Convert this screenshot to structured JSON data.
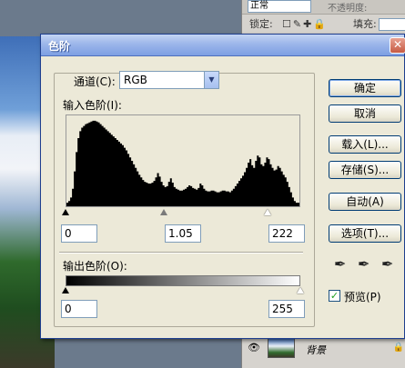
{
  "background": {
    "layers_panel": {
      "blend_mode": "正常",
      "opacity_label": "不透明度:",
      "lock_label": "锁定:",
      "lock_icons": "☐✎✚🔒",
      "fill_label": "填充:",
      "layer_name": "背景"
    }
  },
  "dialog": {
    "title": "色阶",
    "channel_label": "通道(C):",
    "channel_value": "RGB",
    "input_levels_label": "输入色阶(I):",
    "input_black": "0",
    "input_gamma": "1.05",
    "input_white": "222",
    "output_levels_label": "输出色阶(O):",
    "output_black": "0",
    "output_white": "255",
    "buttons": {
      "ok": "确定",
      "cancel": "取消",
      "load": "载入(L)...",
      "save": "存储(S)...",
      "auto": "自动(A)",
      "options": "选项(T)..."
    },
    "preview_label": "预览(P)",
    "preview_checked": true,
    "close_glyph": "✕"
  },
  "histogram": {
    "levels": [
      4,
      6,
      10,
      20,
      40,
      62,
      78,
      86,
      90,
      92,
      94,
      95,
      96,
      97,
      98,
      98,
      97,
      96,
      94,
      92,
      90,
      88,
      86,
      84,
      82,
      80,
      78,
      76,
      74,
      72,
      70,
      67,
      64,
      60,
      56,
      52,
      48,
      44,
      40,
      36,
      33,
      30,
      28,
      27,
      26,
      26,
      27,
      29,
      33,
      38,
      34,
      28,
      24,
      22,
      23,
      28,
      32,
      27,
      22,
      20,
      19,
      18,
      18,
      19,
      20,
      22,
      24,
      23,
      21,
      20,
      19,
      21,
      26,
      24,
      20,
      18,
      17,
      17,
      18,
      18,
      17,
      16,
      16,
      17,
      18,
      18,
      17,
      17,
      16,
      18,
      20,
      23,
      26,
      29,
      32,
      35,
      39,
      44,
      50,
      54,
      47,
      44,
      52,
      58,
      56,
      48,
      46,
      50,
      56,
      54,
      48,
      44,
      41,
      42,
      46,
      44,
      40,
      36,
      33,
      28,
      22,
      16,
      10,
      6,
      4,
      4
    ]
  }
}
